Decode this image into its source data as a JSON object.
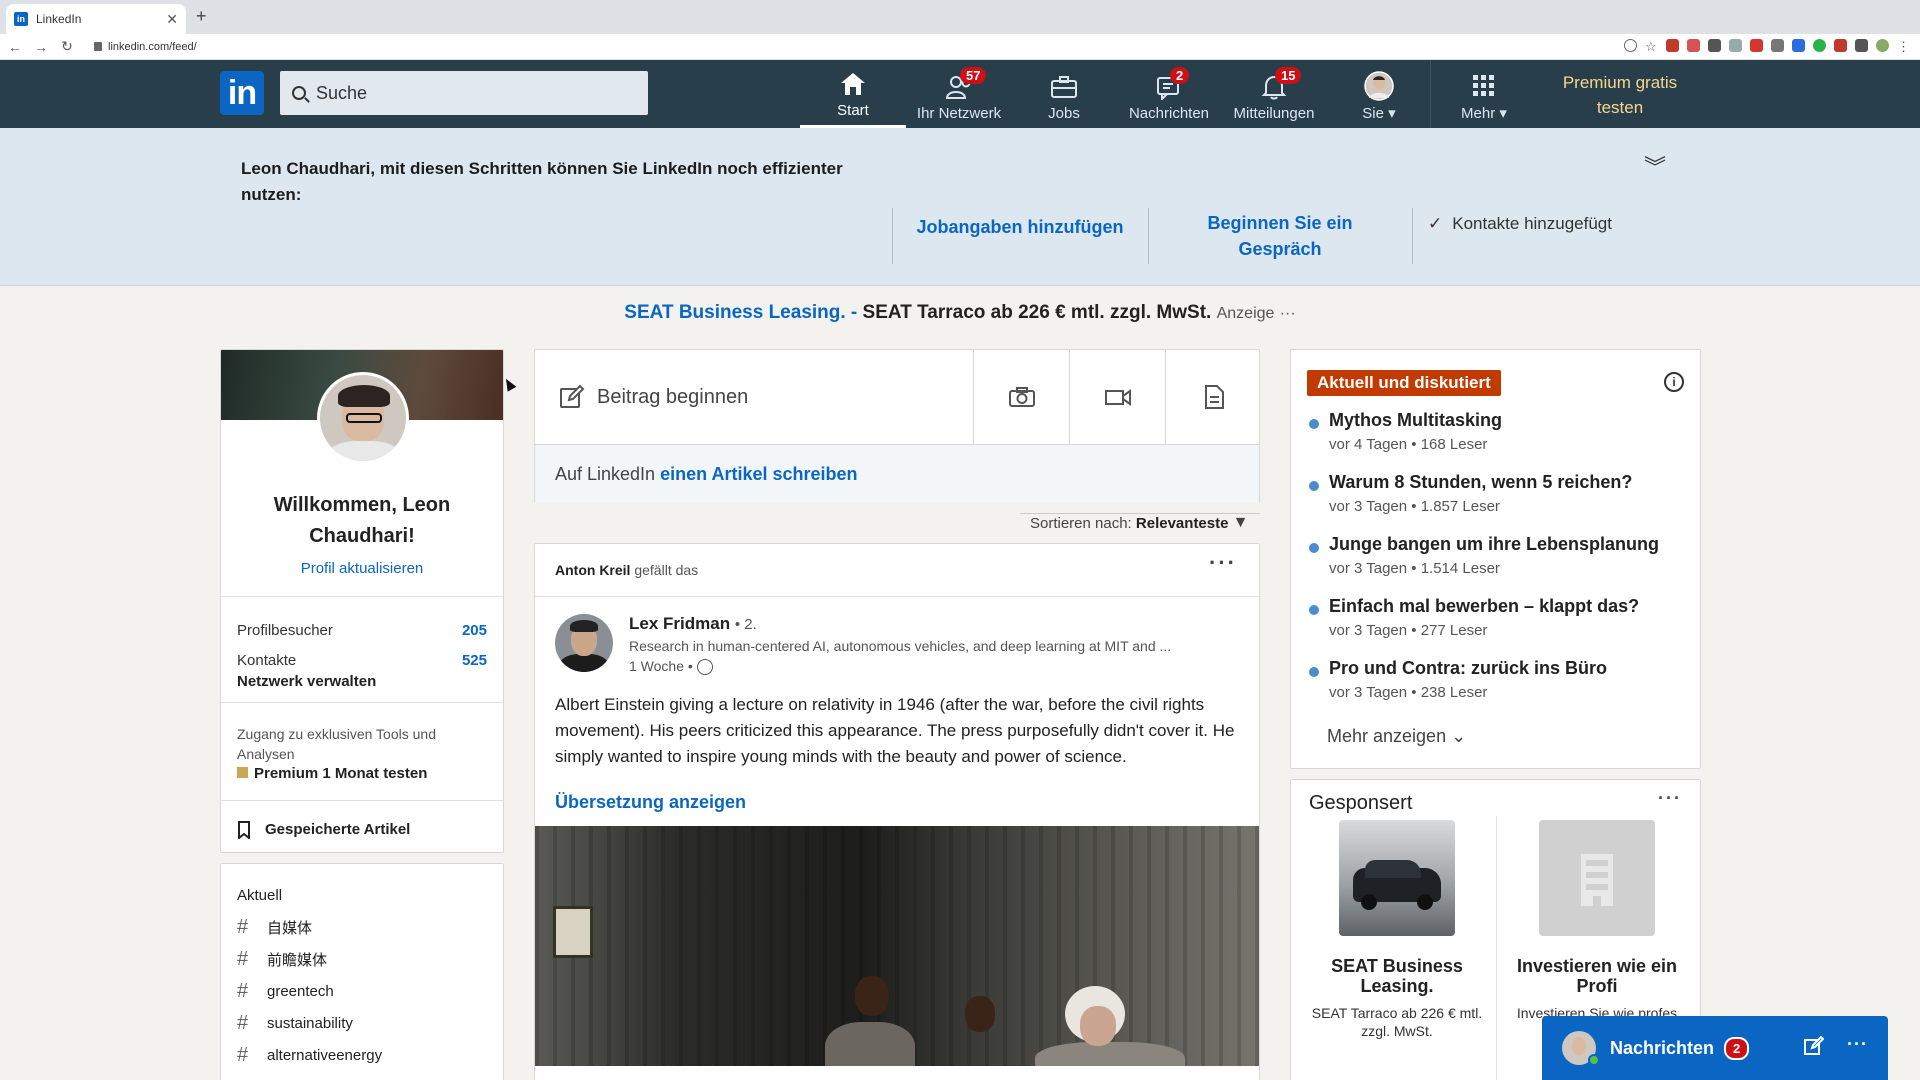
{
  "browser": {
    "tab_title": "LinkedIn",
    "tab_favicon": "in",
    "new_tab": "+",
    "url": "linkedin.com/feed/"
  },
  "header": {
    "logo": "in",
    "search_placeholder": "Suche",
    "nav": [
      {
        "label": "Start",
        "icon": "home-icon",
        "badge": ""
      },
      {
        "label": "Ihr Netzwerk",
        "icon": "network-icon",
        "badge": "57"
      },
      {
        "label": "Jobs",
        "icon": "briefcase-icon",
        "badge": ""
      },
      {
        "label": "Nachrichten",
        "icon": "messages-icon",
        "badge": "2"
      },
      {
        "label": "Mitteilungen",
        "icon": "bell-icon",
        "badge": "15"
      },
      {
        "label": "Sie",
        "icon": "avatar-icon",
        "badge": ""
      },
      {
        "label": "Mehr",
        "icon": "grid-icon",
        "badge": ""
      }
    ],
    "premium_line1": "Premium gratis",
    "premium_line2": "testen"
  },
  "banner": {
    "intro_line1": "Leon Chaudhari, mit diesen Schritten können Sie LinkedIn noch effizienter",
    "intro_line2": "nutzen:",
    "step1": "Jobangaben hinzufügen",
    "step2_line1": "Beginnen Sie ein",
    "step2_line2": "Gespräch",
    "step3": "Kontakte hinzugefügt"
  },
  "ad": {
    "brand": "SEAT Business Leasing. -",
    "text": "SEAT Tarraco ab 226 € mtl. zzgl. MwSt.",
    "tag": "Anzeige",
    "more": "···"
  },
  "profile": {
    "welcome_line1": "Willkommen, Leon",
    "welcome_line2": "Chaudhari!",
    "update_link": "Profil aktualisieren",
    "visitors_label": "Profilbesucher",
    "visitors_value": "205",
    "contacts_label": "Kontakte",
    "contacts_value": "525",
    "manage_network": "Netzwerk verwalten",
    "tools_line1": "Zugang zu exklusiven Tools und",
    "tools_line2": "Analysen",
    "premium_trial": "Premium 1 Monat testen",
    "saved_articles": "Gespeicherte Artikel"
  },
  "current": {
    "title": "Aktuell",
    "hashtags": [
      "自媒体",
      "前瞻媒体",
      "greentech",
      "sustainability",
      "alternativeenergy"
    ]
  },
  "share": {
    "start_post": "Beitrag beginnen",
    "article_prefix": "Auf LinkedIn",
    "article_link": "einen Artikel schreiben"
  },
  "sort": {
    "label": "Sortieren nach:",
    "value": "Relevanteste"
  },
  "post": {
    "liker": "Anton Kreil",
    "liked_text": "gefällt das",
    "author": "Lex Fridman",
    "degree": "• 2.",
    "headline": "Research in human-centered AI, autonomous vehicles, and deep learning at MIT and ...",
    "time": "1 Woche •",
    "text": "Albert Einstein giving a lecture on relativity in 1946 (after the war, before the civil rights movement). His peers criticized this appearance. The press purposefully didn't cover it. He simply wanted to inspire young minds with the beauty and power of science.",
    "translate": "Übersetzung anzeigen"
  },
  "trending": {
    "tag": "Aktuell und diskutiert",
    "items": [
      {
        "title": "Mythos Multitasking",
        "meta": "vor 4 Tagen • 168 Leser"
      },
      {
        "title": "Warum 8 Stunden, wenn 5 reichen?",
        "meta": "vor 3 Tagen • 1.857 Leser"
      },
      {
        "title": "Junge bangen um ihre Lebensplanung",
        "meta": "vor 3 Tagen • 1.514 Leser"
      },
      {
        "title": "Einfach mal bewerben – klappt das?",
        "meta": "vor 3 Tagen • 277 Leser"
      },
      {
        "title": "Pro und Contra: zurück ins Büro",
        "meta": "vor 3 Tagen • 238 Leser"
      }
    ],
    "more": "Mehr anzeigen"
  },
  "sponsored": {
    "title": "Gesponsert",
    "ad1_title": "SEAT Business Leasing.",
    "ad1_desc": "SEAT Tarraco ab 226 € mtl. zzgl. MwSt.",
    "ad2_title": "Investieren wie ein Profi",
    "ad2_desc": "Investieren Sie wie profes"
  },
  "messaging": {
    "label": "Nachrichten",
    "badge": "2"
  },
  "colors": {
    "header_bg": "#283e4a",
    "brand_blue": "#0a66c2",
    "badge_red": "#cc1016",
    "premium_gold": "#f5d78e",
    "trending_tag": "#c13b00"
  }
}
